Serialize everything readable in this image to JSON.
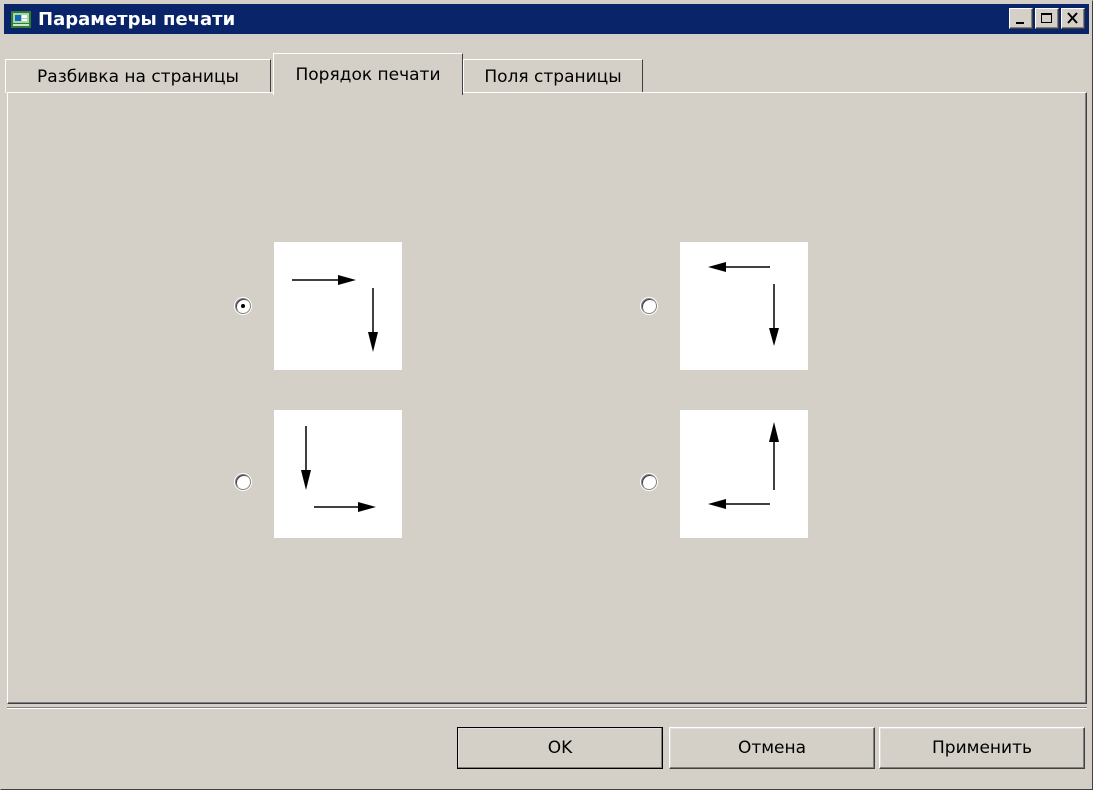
{
  "window": {
    "title": "Параметры печати",
    "controls": {
      "minimize": "minimize-icon",
      "maximize": "maximize-icon",
      "close": "close-icon"
    }
  },
  "tabs": [
    {
      "label": "Разбивка на страницы",
      "active": false
    },
    {
      "label": "Порядок печати",
      "active": true
    },
    {
      "label": "Поля страницы",
      "active": false
    }
  ],
  "print_order": {
    "options": [
      {
        "id": "right-then-down",
        "icon": "arrow-right-then-down-icon",
        "selected": true
      },
      {
        "id": "left-then-down",
        "icon": "arrow-left-then-down-icon",
        "selected": false
      },
      {
        "id": "down-then-right",
        "icon": "arrow-down-then-right-icon",
        "selected": false
      },
      {
        "id": "left-then-up",
        "icon": "arrow-left-then-up-icon",
        "selected": false
      }
    ]
  },
  "buttons": {
    "ok": "OK",
    "cancel": "Отмена",
    "apply": "Применить"
  },
  "colors": {
    "titlebar": "#0a246a",
    "dialog": "#d4d0c8",
    "preview_bg": "#ffffff"
  }
}
